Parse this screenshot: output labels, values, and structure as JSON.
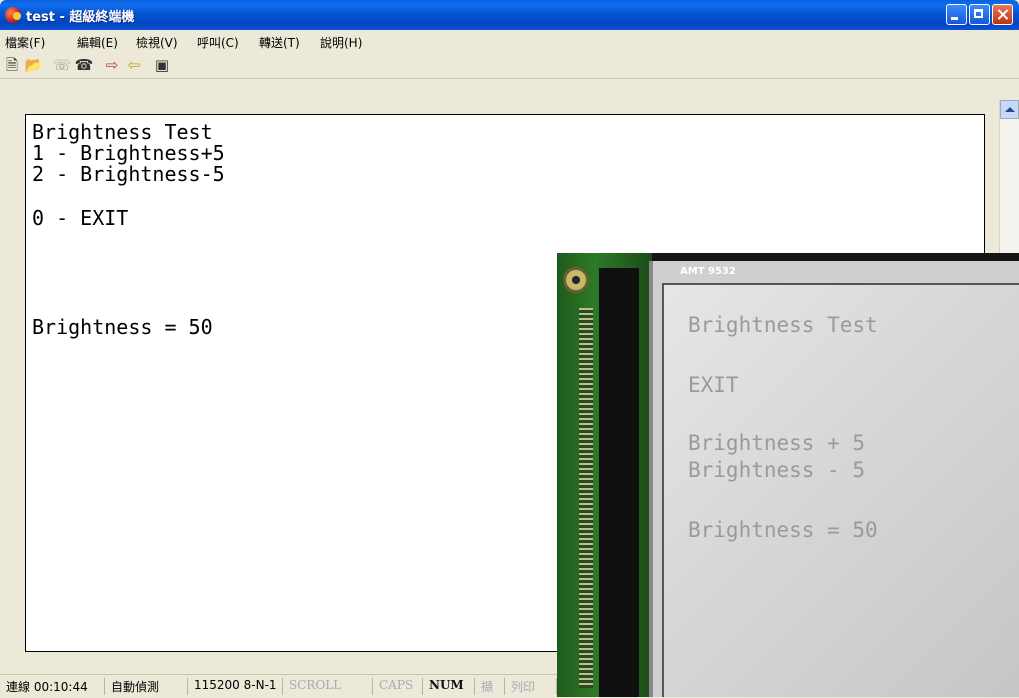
{
  "window": {
    "title": "test - 超級終端機"
  },
  "menu": [
    "檔案(F)",
    "編輯(E)",
    "檢視(V)",
    "呼叫(C)",
    "轉送(T)",
    "說明(H)"
  ],
  "toolbar_icons": [
    "new-icon",
    "open-icon",
    "disconnect-icon",
    "dial-icon",
    "send-icon",
    "receive-icon",
    "properties-icon"
  ],
  "terminal": {
    "lines": [
      "Brightness Test",
      "1 - Brightness+5",
      "2 - Brightness-5",
      "0 - EXIT",
      "Brightness = 50"
    ]
  },
  "status": {
    "connected": "連線 00:10:44",
    "detect": "自動偵測",
    "port": "115200 8-N-1",
    "scroll": "SCROLL",
    "caps": "CAPS",
    "num": "NUM",
    "capture": "擷",
    "print": "列印"
  },
  "photo": {
    "label": "AMT 9532",
    "lcd_lines": [
      "Brightness Test",
      "EXIT",
      "Brightness + 5",
      "Brightness - 5",
      "Brightness = 50"
    ]
  }
}
